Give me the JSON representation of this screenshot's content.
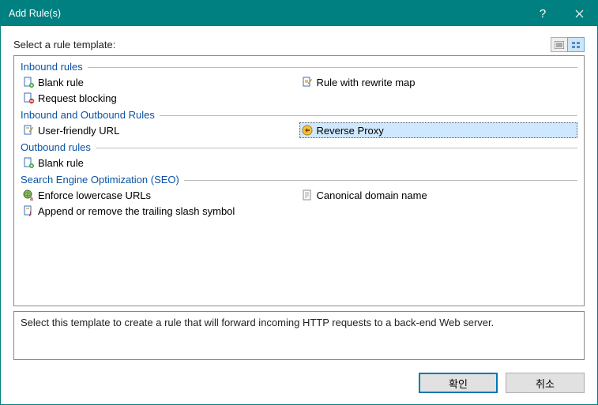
{
  "title": "Add Rule(s)",
  "header_label": "Select a rule template:",
  "groups": {
    "inbound": {
      "label": "Inbound rules",
      "blank": "Blank rule",
      "rewrite_map": "Rule with rewrite map",
      "request_blocking": "Request blocking"
    },
    "in_out": {
      "label": "Inbound and Outbound Rules",
      "user_friendly": "User-friendly URL",
      "reverse_proxy": "Reverse Proxy"
    },
    "outbound": {
      "label": "Outbound rules",
      "blank": "Blank rule"
    },
    "seo": {
      "label": "Search Engine Optimization (SEO)",
      "lowercase": "Enforce lowercase URLs",
      "canonical": "Canonical domain name",
      "slash": "Append or remove the trailing slash symbol"
    }
  },
  "description": "Select this template to create a rule that will forward incoming HTTP requests to a back-end Web server.",
  "buttons": {
    "ok": "확인",
    "cancel": "취소"
  }
}
